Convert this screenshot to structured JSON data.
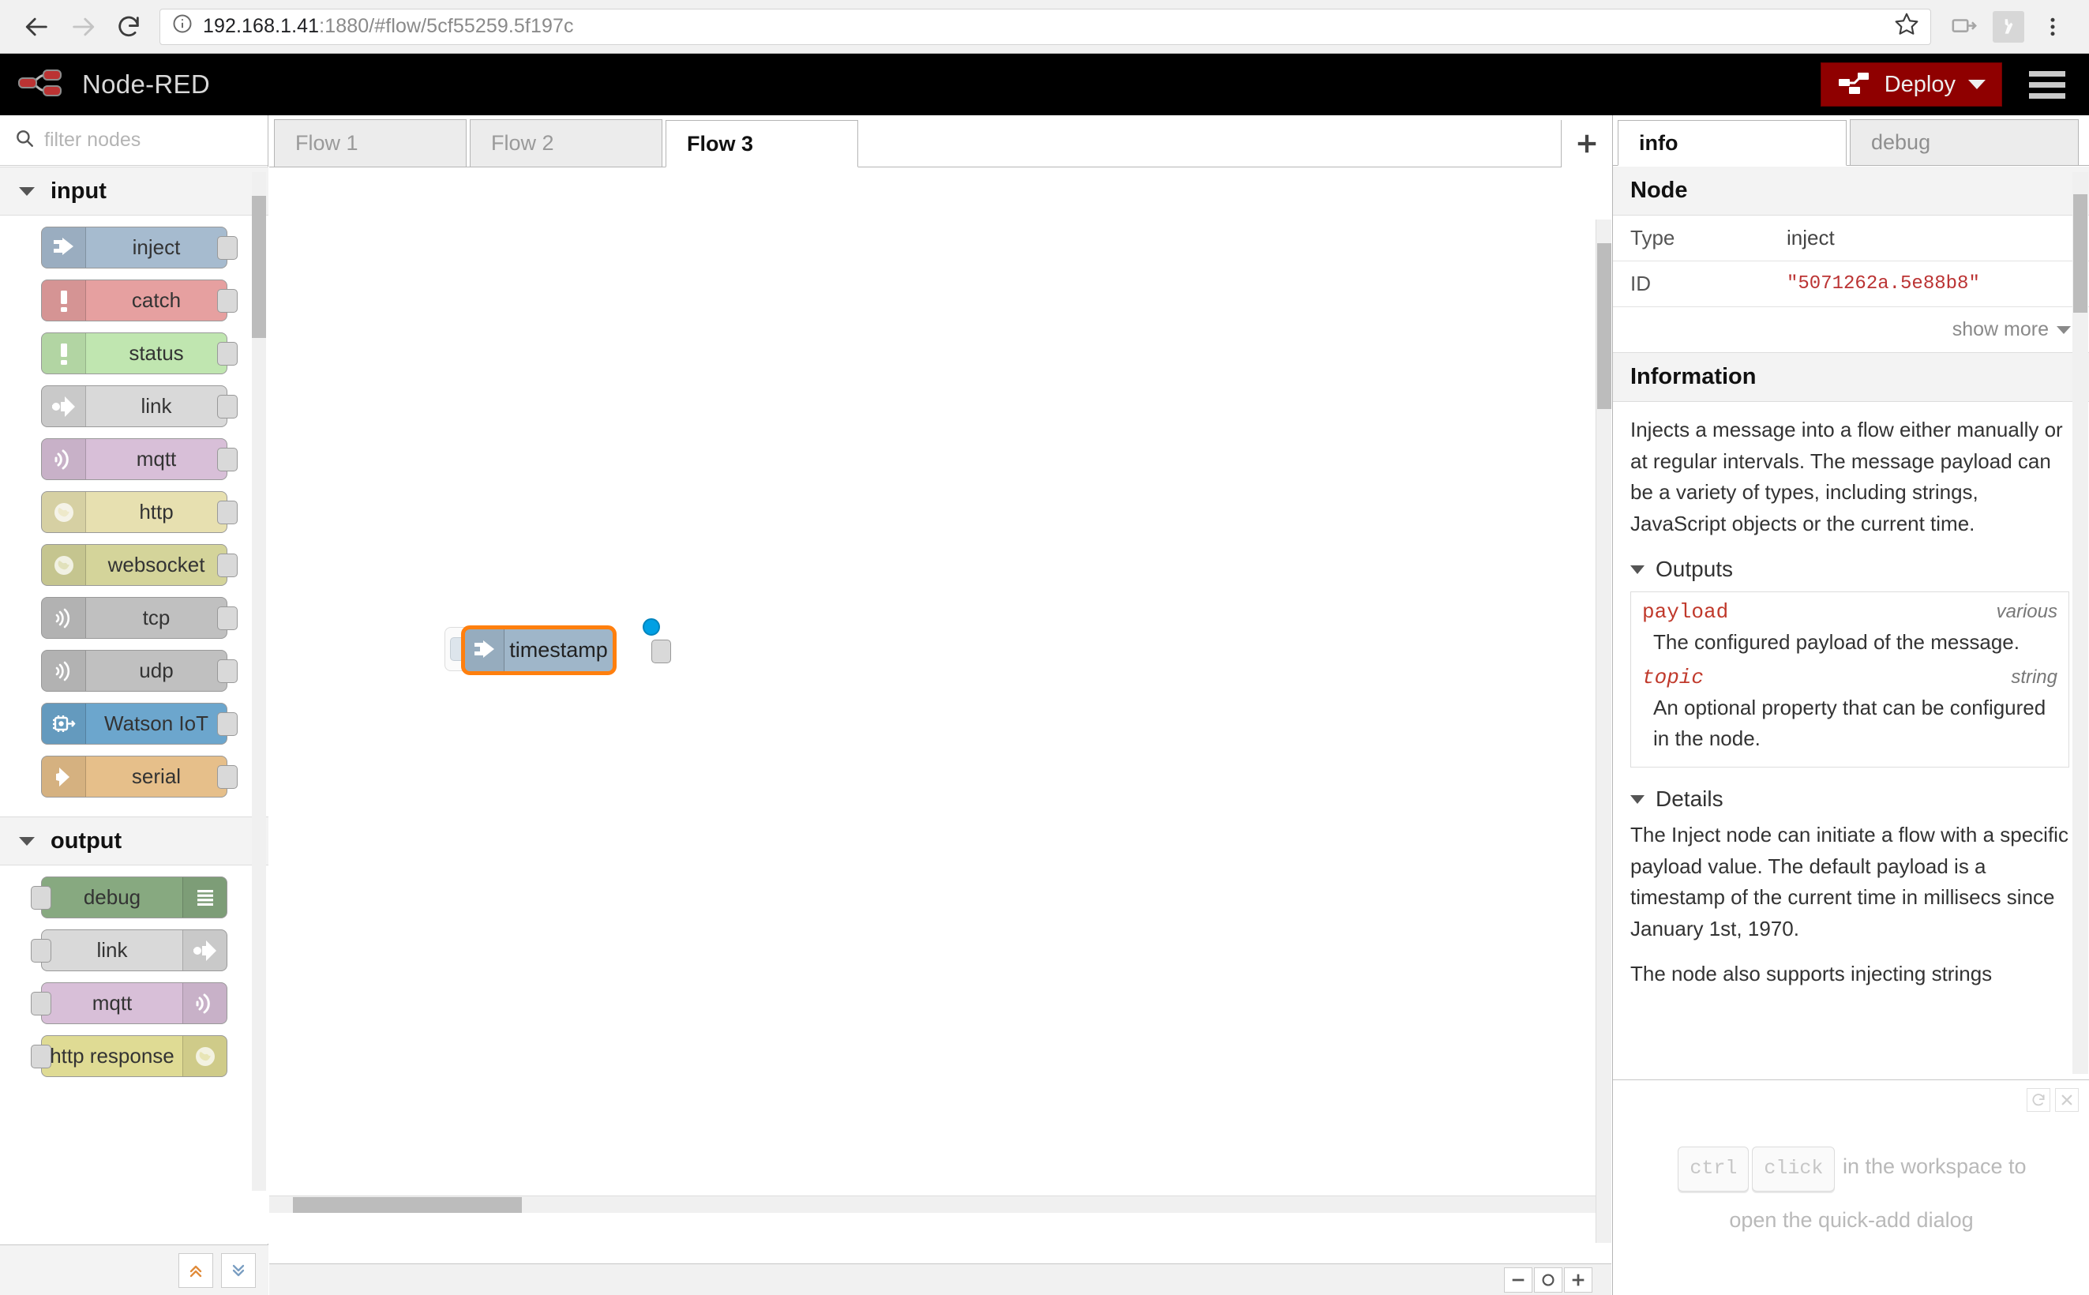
{
  "browser": {
    "back_icon": "back-arrow-icon",
    "forward_icon": "forward-arrow-icon",
    "reload_icon": "reload-icon",
    "site_info_icon": "info-circle-icon",
    "url_host": "192.168.1.41",
    "url_path": ":1880/#flow/5cf55259.5f197c",
    "url_full": "192.168.1.41:1880/#flow/5cf55259.5f197c",
    "bookmark_icon": "star-icon",
    "cast_icon": "cast-icon",
    "pdf_ext_icon": "acrobat-pdf-icon",
    "menu_icon": "three-dot-menu-icon"
  },
  "header": {
    "logo_icon": "node-red-logo-icon",
    "title": "Node-RED",
    "deploy_label": "Deploy",
    "deploy_icon": "deploy-icon",
    "deploy_caret_icon": "chevron-down-icon",
    "deploy_color": "#8f0000",
    "menu_icon": "hamburger-menu-icon"
  },
  "palette": {
    "search_placeholder": "filter nodes",
    "search_value": "",
    "search_icon": "search-icon",
    "collapse_all_icon": "double-chevron-up-icon",
    "expand_all_icon": "double-chevron-down-icon",
    "categories": [
      {
        "name": "input",
        "nodes": [
          {
            "label": "inject",
            "color": "#a6bbcf",
            "icon": "inject-arrow-icon",
            "side": "in"
          },
          {
            "label": "catch",
            "color": "#e6a0a0",
            "icon": "exclamation-icon",
            "side": "in"
          },
          {
            "label": "status",
            "color": "#c0e6b0",
            "icon": "exclamation-icon",
            "side": "in"
          },
          {
            "label": "link",
            "color": "#d9d9d9",
            "icon": "link-in-icon",
            "side": "in"
          },
          {
            "label": "mqtt",
            "color": "#d8bfd8",
            "icon": "mqtt-wave-icon",
            "side": "in"
          },
          {
            "label": "http",
            "color": "#e7e0b0",
            "icon": "globe-icon",
            "side": "in"
          },
          {
            "label": "websocket",
            "color": "#d4d49a",
            "icon": "globe-icon",
            "side": "in"
          },
          {
            "label": "tcp",
            "color": "#c0c0c0",
            "icon": "serial-wave-icon",
            "side": "in"
          },
          {
            "label": "udp",
            "color": "#c0c0c0",
            "icon": "serial-wave-icon",
            "side": "in"
          },
          {
            "label": "Watson IoT",
            "color": "#6ca6cd",
            "icon": "chip-icon",
            "side": "in"
          },
          {
            "label": "serial",
            "color": "#e6bf8a",
            "icon": "serial-arrow-icon",
            "side": "in"
          }
        ]
      },
      {
        "name": "output",
        "nodes": [
          {
            "label": "debug",
            "color": "#87a980",
            "icon": "debug-list-icon",
            "side": "out"
          },
          {
            "label": "link",
            "color": "#d9d9d9",
            "icon": "link-out-icon",
            "side": "out"
          },
          {
            "label": "mqtt",
            "color": "#d8bfd8",
            "icon": "mqtt-wave-icon",
            "side": "out"
          },
          {
            "label": "http response",
            "color": "#dfdb94",
            "icon": "globe-icon",
            "side": "out"
          }
        ]
      }
    ]
  },
  "flows": {
    "tabs": [
      {
        "label": "Flow 1",
        "active": false
      },
      {
        "label": "Flow 2",
        "active": false
      },
      {
        "label": "Flow 3",
        "active": true
      }
    ],
    "add_tab_icon": "plus-icon",
    "canvas": {
      "nodes": [
        {
          "label": "timestamp",
          "type": "inject",
          "color": "#9fb6c9",
          "selected": true,
          "changed": true,
          "selection_color": "#ff7f0e",
          "changed_dot_color": "#00a0e4",
          "icon": "inject-arrow-icon"
        }
      ]
    },
    "zoom_out_icon": "zoom-out-icon",
    "zoom_reset_icon": "zoom-reset-icon",
    "zoom_in_icon": "zoom-in-icon"
  },
  "sidebar": {
    "tabs": [
      {
        "label": "info",
        "active": true
      },
      {
        "label": "debug",
        "active": false
      }
    ],
    "node_section_title": "Node",
    "properties": [
      {
        "key": "Type",
        "value": "inject",
        "mono": false
      },
      {
        "key": "ID",
        "value": "\"5071262a.5e88b8\"",
        "mono": true
      }
    ],
    "show_more_label": "show more",
    "show_more_icon": "chevron-down-icon",
    "information_title": "Information",
    "information_body": "Injects a message into a flow either manually or at regular intervals. The message payload can be a variety of types, including strings, JavaScript objects or the current time.",
    "outputs_title": "Outputs",
    "outputs": [
      {
        "name": "payload",
        "type": "various",
        "italic": false,
        "description": "The configured payload of the message."
      },
      {
        "name": "topic",
        "type": "string",
        "italic": true,
        "description": "An optional property that can be configured in the node."
      }
    ],
    "details_title": "Details",
    "details_body": "The Inject node can initiate a flow with a specific payload value. The default payload is a timestamp of the current time in millisecs since January 1st, 1970.",
    "details_body_cut": "The node also supports injecting strings",
    "tip": {
      "refresh_icon": "refresh-icon",
      "close_icon": "close-icon",
      "key1": "ctrl",
      "key2": "click",
      "text_after": "in the workspace to",
      "text_line2": "open the quick-add dialog"
    }
  }
}
